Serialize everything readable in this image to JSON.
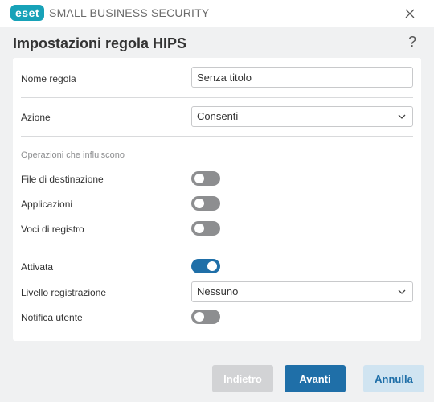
{
  "app": {
    "logo_text": "eset",
    "product_name": "SMALL BUSINESS SECURITY"
  },
  "header": {
    "title": "Impostazioni regola HIPS",
    "help": "?"
  },
  "form": {
    "rule_name": {
      "label": "Nome regola",
      "value": "Senza titolo"
    },
    "action": {
      "label": "Azione",
      "value": "Consenti"
    },
    "section_title": "Operazioni che influiscono",
    "target_files": {
      "label": "File di destinazione",
      "enabled": false
    },
    "applications": {
      "label": "Applicazioni",
      "enabled": false
    },
    "registry": {
      "label": "Voci di registro",
      "enabled": false
    },
    "enabled": {
      "label": "Attivata",
      "enabled": true
    },
    "log_level": {
      "label": "Livello registrazione",
      "value": "Nessuno"
    },
    "notify_user": {
      "label": "Notifica utente",
      "enabled": false
    }
  },
  "footer": {
    "back_label": "Indietro",
    "next_label": "Avanti",
    "cancel_label": "Annulla"
  },
  "colors": {
    "accent": "#1f6fa8",
    "brand": "#17a2b8",
    "toggle_off": "#8d8e90"
  }
}
